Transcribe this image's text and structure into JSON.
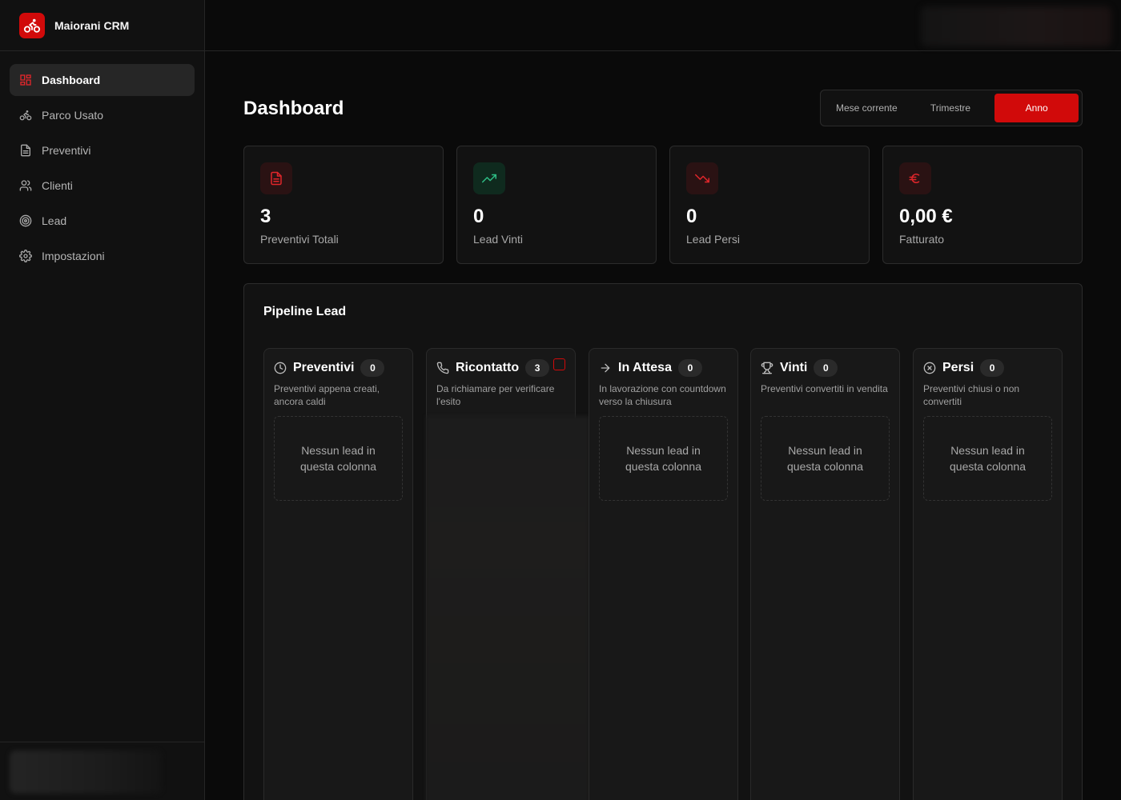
{
  "app": {
    "name": "Maiorani CRM",
    "logo_icon": "bicycle-icon",
    "accent": "#d10a0a"
  },
  "sidebar": {
    "items": [
      {
        "label": "Dashboard",
        "icon": "dashboard-icon",
        "active": true
      },
      {
        "label": "Parco Usato",
        "icon": "bicycle-icon",
        "active": false
      },
      {
        "label": "Preventivi",
        "icon": "document-icon",
        "active": false
      },
      {
        "label": "Clienti",
        "icon": "users-icon",
        "active": false
      },
      {
        "label": "Lead",
        "icon": "target-icon",
        "active": false
      },
      {
        "label": "Impostazioni",
        "icon": "gear-icon",
        "active": false
      }
    ]
  },
  "page": {
    "title": "Dashboard"
  },
  "period": {
    "options": [
      "Mese corrente",
      "Trimestre",
      "Anno"
    ],
    "selected": "Anno"
  },
  "stats": [
    {
      "value": "3",
      "label": "Preventivi Totali",
      "icon": "document-icon",
      "color": "#e0262b"
    },
    {
      "value": "0",
      "label": "Lead Vinti",
      "icon": "trending-up-icon",
      "color": "#2ebd85"
    },
    {
      "value": "0",
      "label": "Lead Persi",
      "icon": "trending-down-icon",
      "color": "#e0262b"
    },
    {
      "value": "0,00 €",
      "label": "Fatturato",
      "icon": "euro-icon",
      "color": "#e0262b"
    }
  ],
  "pipeline": {
    "title": "Pipeline Lead",
    "columns": [
      {
        "title": "Preventivi",
        "count": "0",
        "icon": "clock-icon",
        "desc": "Preventivi appena creati, ancora caldi",
        "empty": "Nessun lead in questa colonna"
      },
      {
        "title": "Ricontatto",
        "count": "3",
        "icon": "phone-icon",
        "desc": "Da richiamare per verificare l'esito",
        "empty": ""
      },
      {
        "title": "In Attesa",
        "count": "0",
        "icon": "arrow-right-icon",
        "desc": "In lavorazione con countdown verso la chiusura",
        "empty": "Nessun lead in questa colonna"
      },
      {
        "title": "Vinti",
        "count": "0",
        "icon": "trophy-icon",
        "desc": "Preventivi convertiti in vendita",
        "empty": "Nessun lead in questa colonna"
      },
      {
        "title": "Persi",
        "count": "0",
        "icon": "x-circle-icon",
        "desc": "Preventivi chiusi o non convertiti",
        "empty": "Nessun lead in questa colonna"
      }
    ]
  }
}
